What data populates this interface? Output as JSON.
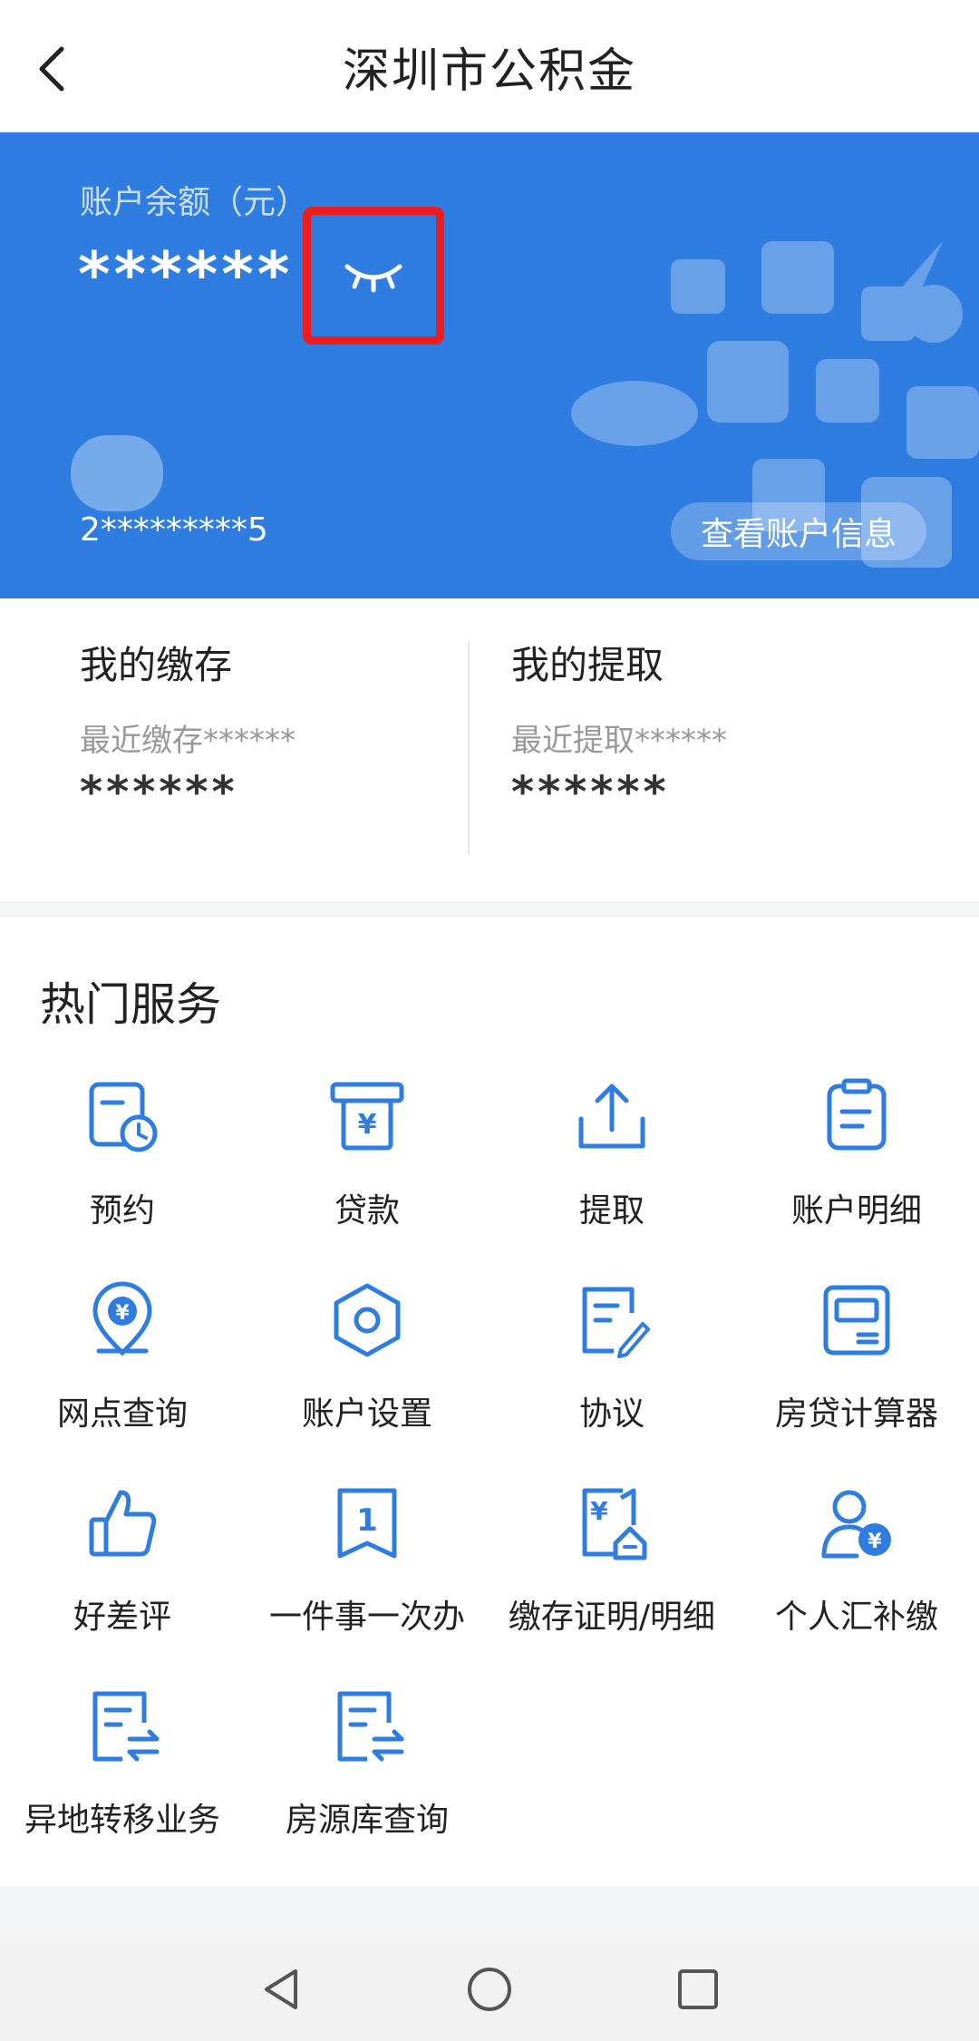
{
  "header": {
    "title": "深圳市公积金",
    "back_icon": "chevron-left-icon"
  },
  "account": {
    "balance_label": "账户余额（元）",
    "balance_value": "******",
    "eye_icon": "eye-closed-icon",
    "account_number": "2*********5",
    "view_info_label": "查看账户信息"
  },
  "summary": {
    "deposit": {
      "title": "我的缴存",
      "recent": "最近缴存******",
      "value": "******"
    },
    "withdraw": {
      "title": "我的提取",
      "recent": "最近提取******",
      "value": "******"
    }
  },
  "services": {
    "title": "热门服务",
    "items": [
      {
        "label": "预约",
        "icon": "calendar-clock-icon"
      },
      {
        "label": "贷款",
        "icon": "atm-yuan-icon"
      },
      {
        "label": "提取",
        "icon": "share-upload-icon"
      },
      {
        "label": "账户明细",
        "icon": "clipboard-list-icon"
      },
      {
        "label": "网点查询",
        "icon": "map-pin-yuan-icon"
      },
      {
        "label": "账户设置",
        "icon": "hexagon-settings-icon"
      },
      {
        "label": "协议",
        "icon": "document-edit-icon"
      },
      {
        "label": "房贷计算器",
        "icon": "calculator-icon"
      },
      {
        "label": "好差评",
        "icon": "thumbs-up-icon"
      },
      {
        "label": "一件事一次办",
        "icon": "bookmark-one-icon"
      },
      {
        "label": "缴存证明/明细",
        "icon": "certificate-yuan-icon"
      },
      {
        "label": "个人汇补缴",
        "icon": "user-yuan-icon"
      },
      {
        "label": "异地转移业务",
        "icon": "document-transfer-icon"
      },
      {
        "label": "房源库查询",
        "icon": "document-transfer-icon"
      }
    ]
  },
  "colors": {
    "primary": "#2f7de1",
    "icon_blue": "#2f7de1",
    "highlight": "#ee1c1c"
  },
  "navbar": {
    "back_icon": "triangle-back-icon",
    "home_icon": "circle-home-icon",
    "recents_icon": "square-recents-icon"
  }
}
